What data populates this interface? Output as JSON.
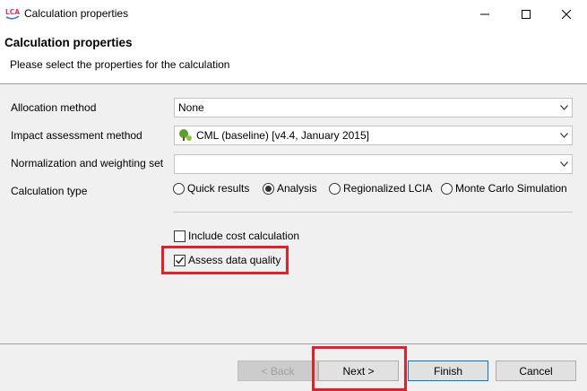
{
  "window": {
    "title": "Calculation properties",
    "app_icon_text": "LCA"
  },
  "banner": {
    "title": "Calculation properties",
    "subtitle": "Please select the properties for the calculation"
  },
  "form": {
    "allocation": {
      "label": "Allocation method",
      "value": "None"
    },
    "impact": {
      "label": "Impact assessment method",
      "value": "CML (baseline) [v4.4, January 2015]"
    },
    "normalization": {
      "label": "Normalization and weighting set",
      "value": ""
    },
    "calc_type": {
      "label": "Calculation type",
      "options": [
        {
          "label": "Quick results",
          "checked": false
        },
        {
          "label": "Analysis",
          "checked": true
        },
        {
          "label": "Regionalized LCIA",
          "checked": false
        },
        {
          "label": "Monte Carlo Simulation",
          "checked": false
        }
      ]
    },
    "cost_calc": {
      "label": "Include cost calculation",
      "checked": false
    },
    "data_quality": {
      "label": "Assess data quality",
      "checked": true
    }
  },
  "buttons": {
    "back": "< Back",
    "next": "Next >",
    "finish": "Finish",
    "cancel": "Cancel"
  },
  "colors": {
    "highlight": "#e0202a",
    "default_button_border": "#0078d7",
    "method_icon": "#5aa02c"
  }
}
